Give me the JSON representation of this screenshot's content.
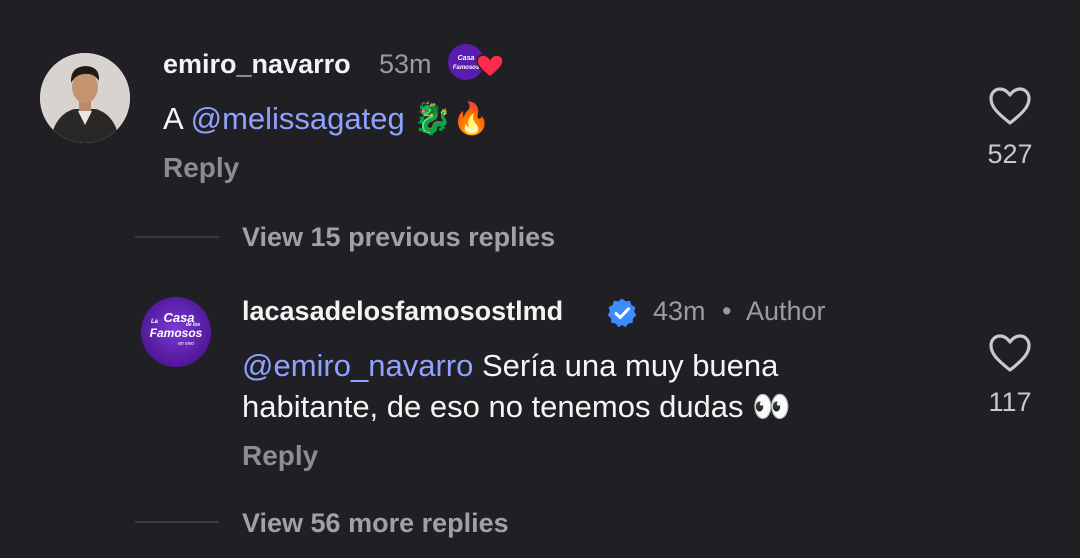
{
  "comments": [
    {
      "username": "emiro_navarro",
      "time": "53m",
      "text_prefix": "A",
      "mention": "@melissagateg",
      "emojis": "🐉🔥",
      "reply_label": "Reply",
      "likes": "527"
    },
    {
      "username": "lacasadelosfamosostlmd",
      "time": "43m",
      "separator": "•",
      "author_label": "Author",
      "mention": "@emiro_navarro",
      "text_line1": "Sería una muy buena",
      "text_line2": "habitante, de eso no tenemos dudas",
      "emojis": "👀",
      "reply_label": "Reply",
      "likes": "117"
    }
  ],
  "view_previous_replies": "View 15 previous replies",
  "view_more_replies": "View 56 more replies",
  "logo_text": {
    "line1": "La",
    "line2": "Casa",
    "line3": "de los",
    "line4": "Famosos",
    "line5": "en vivo"
  },
  "colors": {
    "background": "#1f1f24",
    "mention": "#8fa2ff",
    "verified": "#3d8bff",
    "brand_purple": "#5b1fb4",
    "heart_red": "#ff2b4a"
  }
}
